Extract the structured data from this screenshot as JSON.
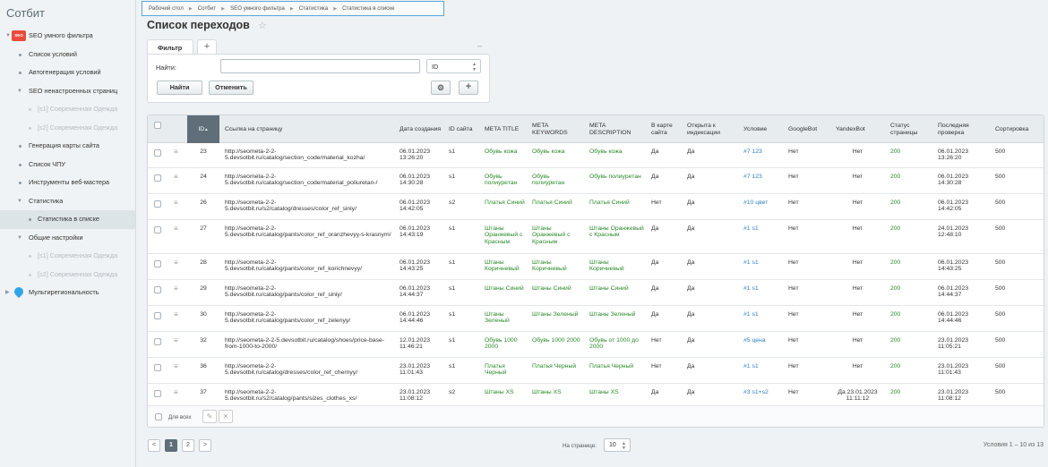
{
  "sidebar": {
    "title": "Сотбит",
    "items": [
      {
        "label": "SEO умного фильтра",
        "level": "root",
        "icon": "seo-logo"
      },
      {
        "label": "Список условий",
        "level": "l1"
      },
      {
        "label": "Автогенерация условий",
        "level": "l1"
      },
      {
        "label": "SEO ненастроенных страниц",
        "level": "l1",
        "expanded": true
      },
      {
        "label": "[s1] Современная Одежда",
        "level": "l2",
        "dim": true
      },
      {
        "label": "[s2] Современная Одежда",
        "level": "l2",
        "dim": true
      },
      {
        "label": "Генерация карты сайта",
        "level": "l1"
      },
      {
        "label": "Список ЧПУ",
        "level": "l1"
      },
      {
        "label": "Инструменты веб-мастера",
        "level": "l1"
      },
      {
        "label": "Статистика",
        "level": "l1",
        "expanded": true
      },
      {
        "label": "Статистика в списке",
        "level": "l2",
        "active": true
      },
      {
        "label": "Общие настройки",
        "level": "l1",
        "expanded": true
      },
      {
        "label": "[s1] Современная Одежда",
        "level": "l2",
        "dim": true
      },
      {
        "label": "[s2] Современная Одежда",
        "level": "l2",
        "dim": true
      },
      {
        "label": "Мультирегиональность",
        "level": "root",
        "icon": "pin-icon"
      }
    ]
  },
  "breadcrumb": [
    "Рабочий стол",
    "Сотбит",
    "SEO умного фильтра",
    "Статистика",
    "Статистика в списке"
  ],
  "page_title": "Список переходов",
  "filter": {
    "tab_label": "Фильтр",
    "add_tab": "+",
    "minimize": "–",
    "find_label": "Найти:",
    "search_value": "",
    "select_value": "ID",
    "find_button": "Найти",
    "cancel_button": "Отменить"
  },
  "grid": {
    "columns": [
      "",
      "",
      "ID",
      "Ссылка на страницу",
      "Дата создания",
      "ID сайта",
      "META TITLE",
      "META KEYWORDS",
      "META DESCRIPTION",
      "В карте сайта",
      "Открыта к индексации",
      "Условие",
      "GoogleBot",
      "YandexBot",
      "Статус страницы",
      "Последняя проверка",
      "Сортировка"
    ],
    "rows": [
      {
        "id": "23",
        "url": "http://seometa-2-2-5.devsotbit.ru/catalog/section_code/material_kozha/",
        "date": "06.01.2023 13:26:20",
        "site": "s1",
        "title": "Обувь кожа",
        "keywords": "Обувь кожа",
        "description": "Обувь кожа",
        "sitemap": "Да",
        "index": "Да",
        "condition": "#7 123",
        "google": "Нет",
        "yandex": "Нет",
        "status": "200",
        "checked": "06.01.2023 13:26:20",
        "sort": "500"
      },
      {
        "id": "24",
        "url": "http://seometa-2-2-5.devsotbit.ru/catalog/section_code/material_poliuretan-/",
        "date": "06.01.2023 14:30:28",
        "site": "s1",
        "title": "Обувь полиуретан",
        "keywords": "Обувь полиуретан",
        "description": "Обувь полиуретан",
        "sitemap": "Да",
        "index": "Да",
        "condition": "#7 123",
        "google": "Нет",
        "yandex": "Нет",
        "status": "200",
        "checked": "06.01.2023 14:30:28",
        "sort": "500"
      },
      {
        "id": "26",
        "url": "http://seometa-2-2-5.devsotbit.ru/s2/catalog/dresses/color_ref_siniy/",
        "date": "06.01.2023 14:42:05",
        "site": "s2",
        "title": "Платья Синий",
        "keywords": "Платья Синий",
        "description": "Платья Синий",
        "sitemap": "Нет",
        "index": "Да",
        "condition": "#10 цвет",
        "google": "Нет",
        "yandex": "Нет",
        "status": "200",
        "checked": "06.01.2023 14:42:05",
        "sort": "500"
      },
      {
        "id": "27",
        "url": "http://seometa-2-2-5.devsotbit.ru/catalog/pants/color_ref_oranzhevyy-s-krasnym/",
        "date": "06.01.2023 14:43:19",
        "site": "s1",
        "title": "Штаны Оранжевый с Красным",
        "keywords": "Штаны Оранжевый с Красным",
        "description": "Штаны Оранжевый с Красным",
        "sitemap": "Да",
        "index": "Да",
        "condition": "#1 s1",
        "google": "Нет",
        "yandex": "Нет",
        "status": "200",
        "checked": "24.01.2023 12:48:10",
        "sort": "500"
      },
      {
        "id": "28",
        "url": "http://seometa-2-2-5.devsotbit.ru/catalog/pants/color_ref_korichnevyy/",
        "date": "06.01.2023 14:43:25",
        "site": "s1",
        "title": "Штаны Коричневый",
        "keywords": "Штаны Коричневый",
        "description": "Штаны Коричневый",
        "sitemap": "Да",
        "index": "Да",
        "condition": "#1 s1",
        "google": "Нет",
        "yandex": "Нет",
        "status": "200",
        "checked": "06.01.2023 14:43:25",
        "sort": "500"
      },
      {
        "id": "29",
        "url": "http://seometa-2-2-5.devsotbit.ru/catalog/pants/color_ref_siniy/",
        "date": "06.01.2023 14:44:37",
        "site": "s1",
        "title": "Штаны Синий",
        "keywords": "Штаны Синий",
        "description": "Штаны Синий",
        "sitemap": "Да",
        "index": "Да",
        "condition": "#1 s1",
        "google": "Нет",
        "yandex": "Нет",
        "status": "200",
        "checked": "06.01.2023 14:44:37",
        "sort": "500"
      },
      {
        "id": "30",
        "url": "http://seometa-2-2-5.devsotbit.ru/catalog/pants/color_ref_zelenyy/",
        "date": "06.01.2023 14:44:46",
        "site": "s1",
        "title": "Штаны Зеленый",
        "keywords": "Штаны Зеленый",
        "description": "Штаны Зеленый",
        "sitemap": "Да",
        "index": "Да",
        "condition": "#1 s1",
        "google": "Нет",
        "yandex": "Нет",
        "status": "200",
        "checked": "06.01.2023 14:44:46",
        "sort": "500"
      },
      {
        "id": "32",
        "url": "http://seometa-2-2-5.devsotbit.ru/catalog/shoes/price-base-from-1000-to-2000/",
        "date": "12.01.2023 11:46:21",
        "site": "s1",
        "title": "Обувь 1000 2000",
        "keywords": "Обувь 1000 2000",
        "description": "Обувь от 1000 до 2000",
        "sitemap": "Нет",
        "index": "Да",
        "condition": "#5 цена",
        "google": "Нет",
        "yandex": "Нет",
        "status": "200",
        "checked": "23.01.2023 11:05:21",
        "sort": "500"
      },
      {
        "id": "36",
        "url": "http://seometa-2-2-5.devsotbit.ru/catalog/dresses/color_ref_chernyy/",
        "date": "23.01.2023 11:01:43",
        "site": "s1",
        "title": "Платья Черный",
        "keywords": "Платья Черный",
        "description": "Платья Черный",
        "sitemap": "Нет",
        "index": "Да",
        "condition": "#1 s1",
        "google": "Нет",
        "yandex": "Нет",
        "status": "200",
        "checked": "23.01.2023 11:01:43",
        "sort": "500"
      },
      {
        "id": "37",
        "url": "http://seometa-2-2-5.devsotbit.ru/s2/catalog/pants/sizes_clothes_xs/",
        "date": "23.01.2023 11:08:12",
        "site": "s2",
        "title": "Штаны XS",
        "keywords": "Штаны XS",
        "description": "Штаны XS",
        "sitemap": "Да",
        "index": "Да",
        "condition": "#3 s1+s2",
        "google": "Нет",
        "yandex": "Да 23.01.2023 11:11:12",
        "status": "200",
        "checked": "23.01.2023 11:08:12",
        "sort": "500"
      }
    ],
    "for_all_label": "Для всех"
  },
  "pagination": {
    "prev": "<",
    "pages": [
      "1",
      "2"
    ],
    "next": ">",
    "per_page_label": "На странице:",
    "per_page_value": "10",
    "total": "Условия 1 – 10 из 13"
  },
  "colors": {
    "sorted_header": "#5f6e78",
    "link": "#2d7fc1",
    "green_text": "#2a8a2a",
    "breadcrumb_border": "#5aa6d8"
  }
}
